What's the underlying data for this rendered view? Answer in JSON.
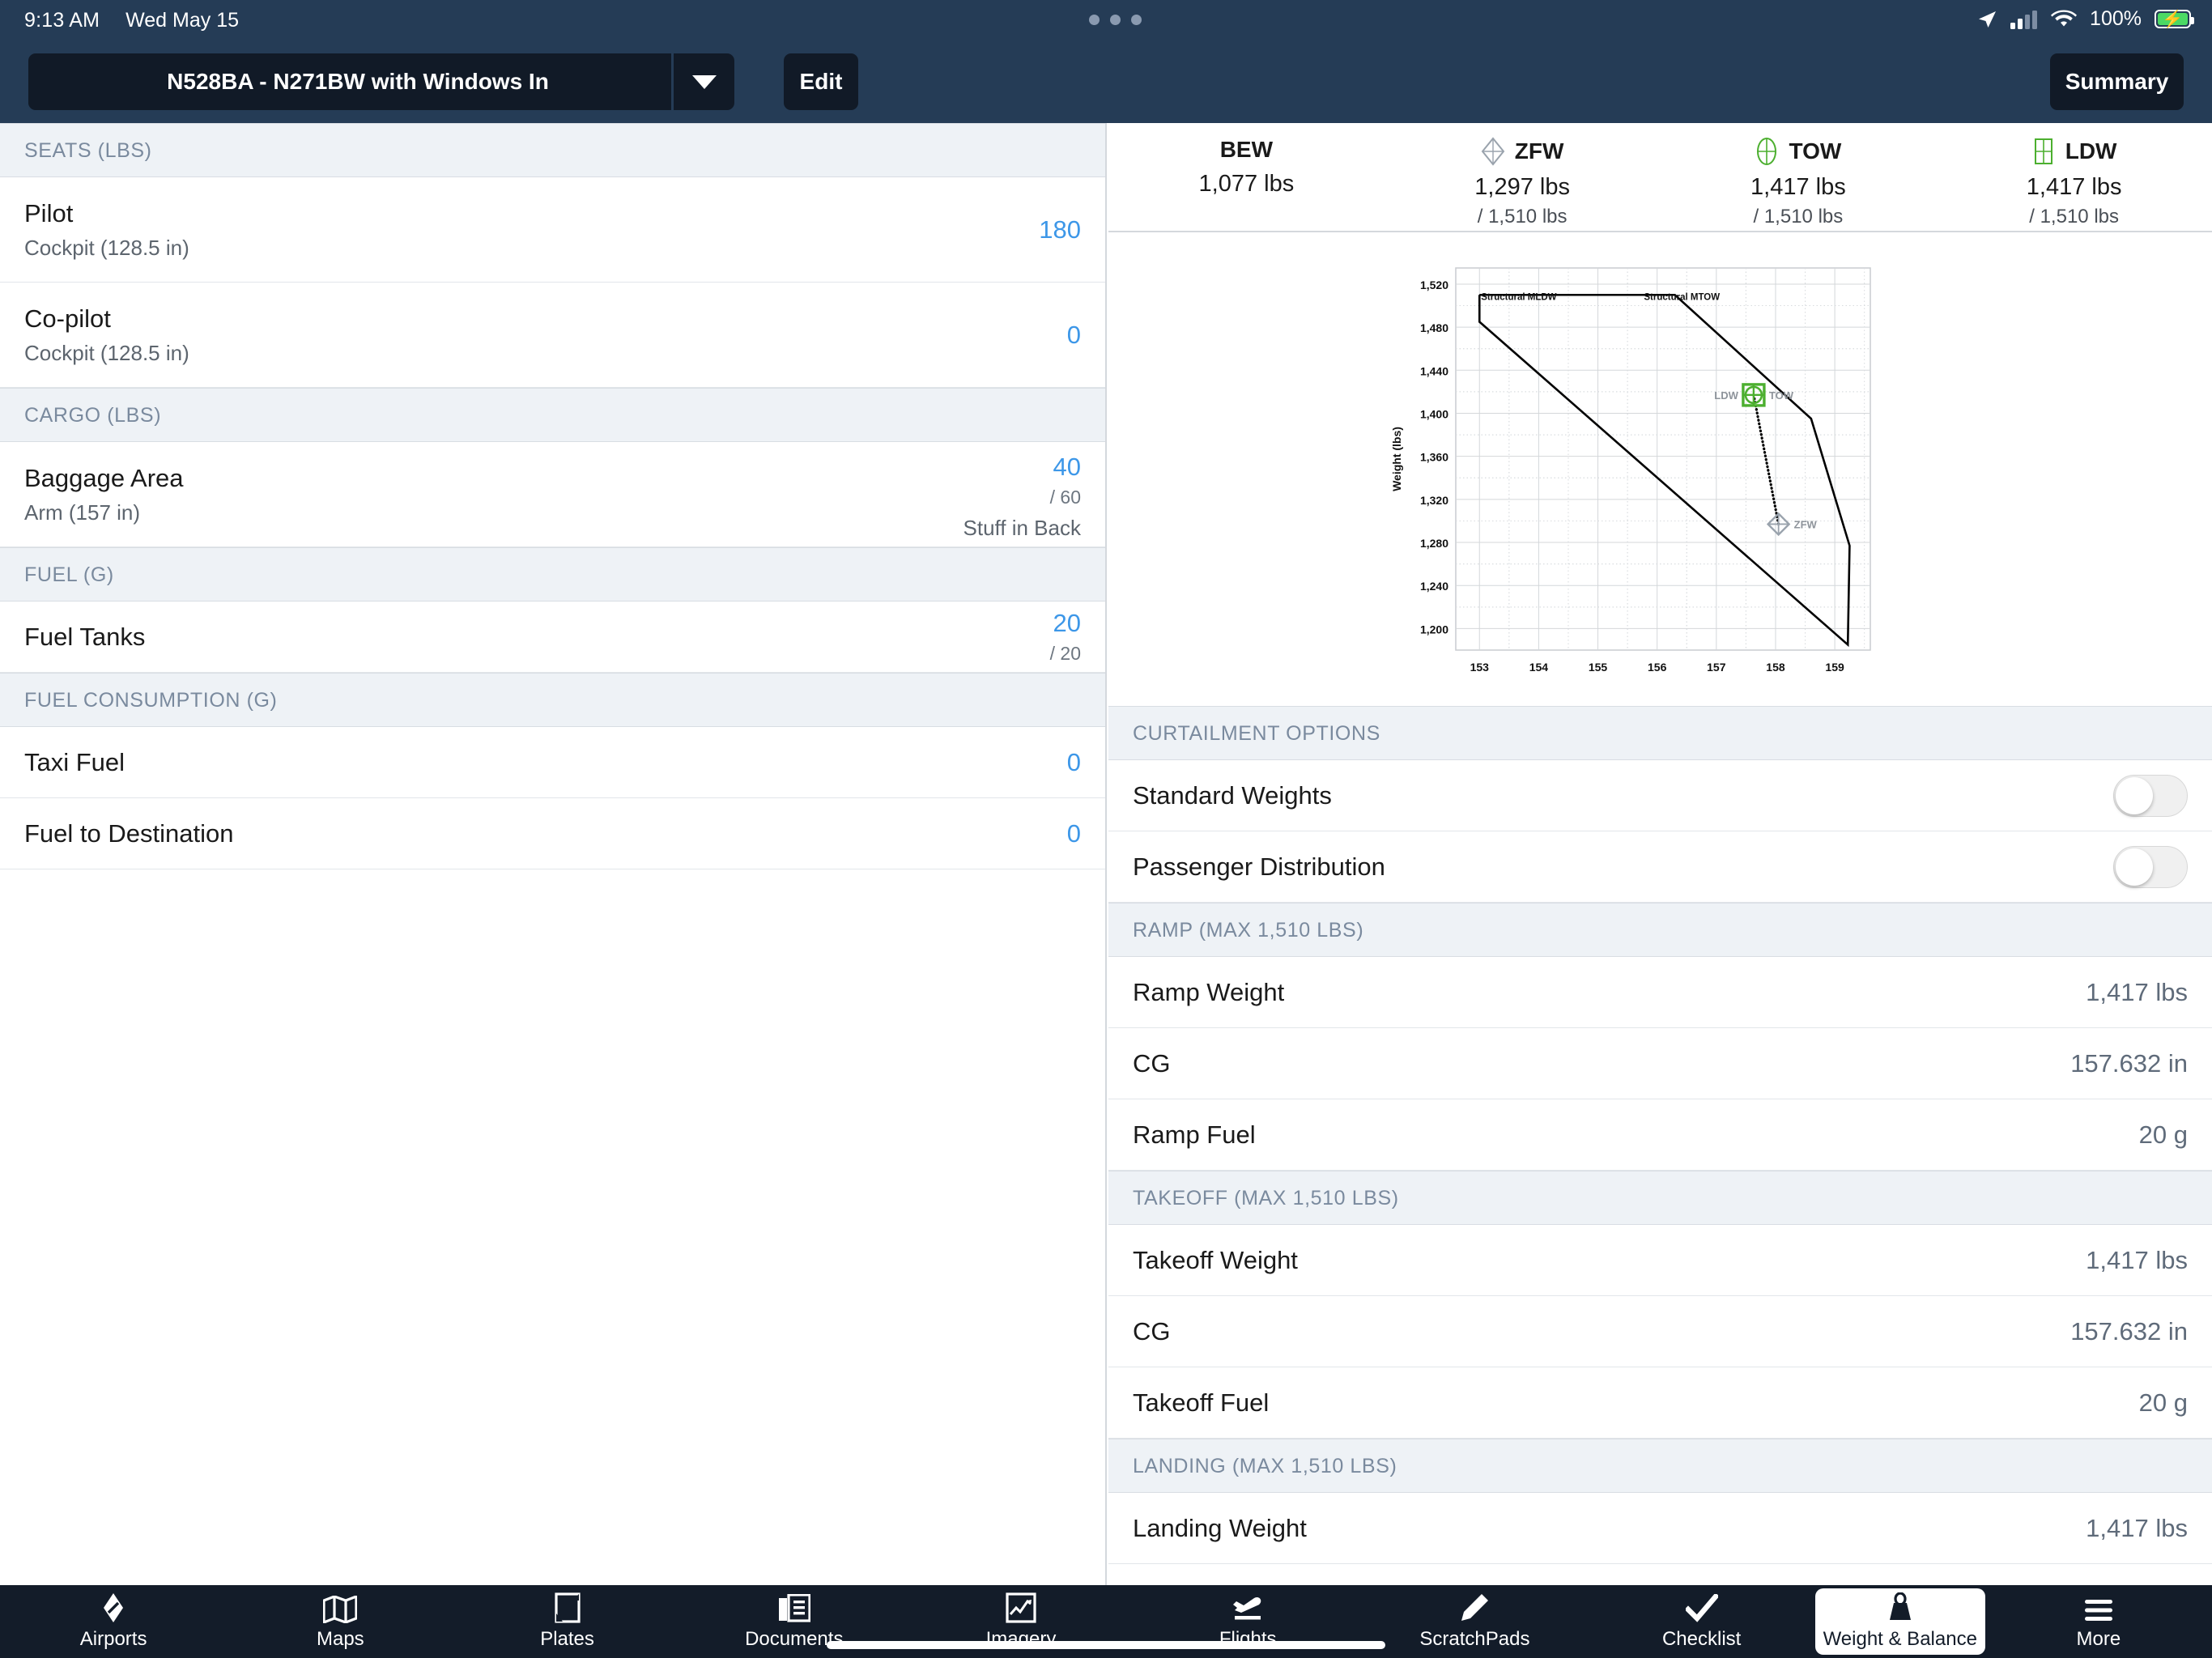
{
  "status_bar": {
    "time": "9:13 AM",
    "date": "Wed May 15",
    "battery_percent": "100%",
    "icons": [
      "location-arrow-icon",
      "cellular-signal-icon",
      "wifi-icon",
      "battery-charging-icon"
    ]
  },
  "nav": {
    "aircraft_name": "N528BA - N271BW with Windows In",
    "edit_label": "Edit",
    "summary_label": "Summary"
  },
  "left_panel": {
    "sections": [
      {
        "header": "SEATS (LBS)",
        "rows": [
          {
            "title": "Pilot",
            "sub": "Cockpit (128.5 in)",
            "value": "180",
            "max": "",
            "note": ""
          },
          {
            "title": "Co-pilot",
            "sub": "Cockpit (128.5 in)",
            "value": "0",
            "max": "",
            "note": ""
          }
        ]
      },
      {
        "header": "CARGO (LBS)",
        "rows": [
          {
            "title": "Baggage Area",
            "sub": "Arm (157 in)",
            "value": "40",
            "max": "/ 60",
            "note": "Stuff in Back"
          }
        ]
      },
      {
        "header": "FUEL (G)",
        "rows": [
          {
            "title": "Fuel Tanks",
            "sub": "",
            "value": "20",
            "max": "/ 20",
            "note": ""
          }
        ]
      },
      {
        "header": "FUEL CONSUMPTION (G)",
        "rows": [
          {
            "title": "Taxi Fuel",
            "sub": "",
            "value": "0",
            "max": "",
            "note": ""
          },
          {
            "title": "Fuel to Destination",
            "sub": "",
            "value": "0",
            "max": "",
            "note": ""
          }
        ]
      }
    ]
  },
  "weights_summary": [
    {
      "icon": "",
      "label": "BEW",
      "value": "1,077 lbs",
      "max": ""
    },
    {
      "icon": "zfw-diamond-icon",
      "label": "ZFW",
      "value": "1,297 lbs",
      "max": "/ 1,510 lbs"
    },
    {
      "icon": "tow-circle-icon",
      "label": "TOW",
      "value": "1,417 lbs",
      "max": "/ 1,510 lbs"
    },
    {
      "icon": "ldw-square-icon",
      "label": "LDW",
      "value": "1,417 lbs",
      "max": "/ 1,510 lbs"
    }
  ],
  "chart_data": {
    "type": "line",
    "title": "",
    "xlabel": "",
    "ylabel": "Weight (lbs)",
    "xlim": [
      152.6,
      159.6
    ],
    "ylim": [
      1180,
      1535
    ],
    "xticks": [
      153,
      154,
      155,
      156,
      157,
      158,
      159
    ],
    "yticks": [
      1200,
      1240,
      1280,
      1320,
      1360,
      1400,
      1440,
      1480,
      1520
    ],
    "grid": true,
    "legend": "none",
    "annotations": [
      {
        "text": "Structural MLDW",
        "x": 153.0,
        "y": 1509
      },
      {
        "text": "Structural MTOW",
        "x": 155.75,
        "y": 1509
      }
    ],
    "series": [
      {
        "name": "CG envelope",
        "type": "line",
        "color": "#000000",
        "points": [
          [
            153.0,
            1510
          ],
          [
            153.0,
            1485
          ],
          [
            159.22,
            1185
          ],
          [
            159.25,
            1277
          ],
          [
            158.6,
            1395
          ],
          [
            156.3,
            1510
          ],
          [
            153.0,
            1510
          ]
        ]
      },
      {
        "name": "CG travel (ZFW to TOW)",
        "type": "dotted-line",
        "color": "#000000",
        "points": [
          [
            158.05,
            1297
          ],
          [
            157.63,
            1417
          ]
        ]
      }
    ],
    "markers": [
      {
        "label": "LDW",
        "x": 157.63,
        "y": 1417,
        "shape": "square",
        "color": "#4caf2f",
        "label_side": "left"
      },
      {
        "label": "TOW",
        "x": 157.63,
        "y": 1417,
        "shape": "circle",
        "color": "#4caf2f",
        "label_side": "right"
      },
      {
        "label": "ZFW",
        "x": 158.05,
        "y": 1297,
        "shape": "diamond",
        "color": "#9aa3ad",
        "label_side": "right"
      }
    ]
  },
  "right_panel": {
    "sections": [
      {
        "header": "CURTAILMENT OPTIONS",
        "type": "toggles",
        "rows": [
          {
            "label": "Standard Weights",
            "state": "off"
          },
          {
            "label": "Passenger Distribution",
            "state": "off"
          }
        ]
      },
      {
        "header": "RAMP (MAX 1,510 LBS)",
        "type": "values",
        "rows": [
          {
            "label": "Ramp Weight",
            "value": "1,417 lbs"
          },
          {
            "label": "CG",
            "value": "157.632 in"
          },
          {
            "label": "Ramp Fuel",
            "value": "20 g"
          }
        ]
      },
      {
        "header": "TAKEOFF (MAX 1,510 LBS)",
        "type": "values",
        "rows": [
          {
            "label": "Takeoff Weight",
            "value": "1,417 lbs"
          },
          {
            "label": "CG",
            "value": "157.632 in"
          },
          {
            "label": "Takeoff Fuel",
            "value": "20 g"
          }
        ]
      },
      {
        "header": "LANDING (MAX 1,510 LBS)",
        "type": "values",
        "rows": [
          {
            "label": "Landing Weight",
            "value": "1,417 lbs"
          }
        ]
      }
    ]
  },
  "tab_bar": {
    "tabs": [
      {
        "label": "Airports",
        "icon": "compass-icon",
        "active": false
      },
      {
        "label": "Maps",
        "icon": "map-icon",
        "active": false
      },
      {
        "label": "Plates",
        "icon": "plate-icon",
        "active": false
      },
      {
        "label": "Documents",
        "icon": "documents-icon",
        "active": false
      },
      {
        "label": "Imagery",
        "icon": "imagery-chart-icon",
        "active": false
      },
      {
        "label": "Flights",
        "icon": "departing-plane-icon",
        "active": false
      },
      {
        "label": "ScratchPads",
        "icon": "pencil-icon",
        "active": false
      },
      {
        "label": "Checklist",
        "icon": "checkmark-icon",
        "active": false
      },
      {
        "label": "Weight & Balance",
        "icon": "weight-icon",
        "active": true
      },
      {
        "label": "More",
        "icon": "hamburger-icon",
        "active": false
      }
    ]
  },
  "colors": {
    "nav_bg": "#253c56",
    "accent_blue": "#3d97e8",
    "tab_bg": "#131c29",
    "marker_green": "#4caf2f",
    "header_text": "#7a8a9e"
  }
}
